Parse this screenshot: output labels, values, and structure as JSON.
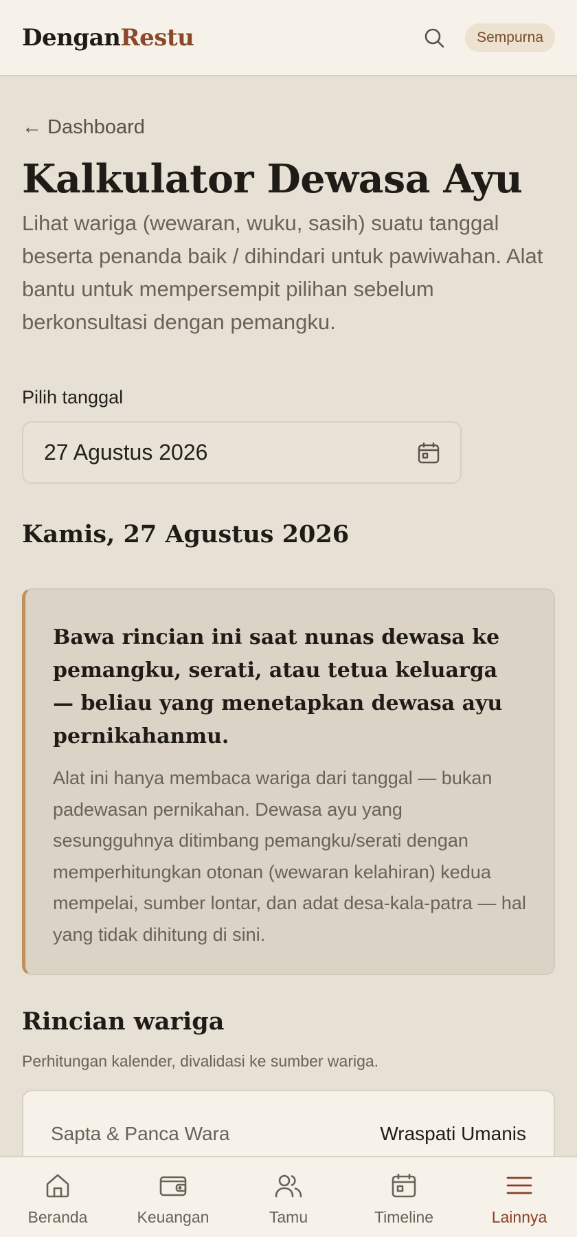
{
  "header": {
    "logo_part1": "Dengan",
    "logo_part2": "Restu",
    "search_icon": "search-icon",
    "plan_badge": "Sempurna"
  },
  "main": {
    "back_link": "← Dashboard",
    "title": "Kalkulator Dewasa Ayu",
    "description": "Lihat wariga (wewaran, wuku, sasih) suatu tanggal beserta penanda baik / dihindari untuk pawiwahan. Alat bantu untuk mempersempit pilihan sebelum berkonsultasi dengan pemangku.",
    "date_field": {
      "label": "Pilih tanggal",
      "value": "27 Agustus 2026",
      "icon": "calendar-icon"
    },
    "selected_date_heading": "Kamis, 27 Agustus 2026",
    "notice": {
      "title": "Bawa rincian ini saat nunas dewasa ke pemangku, serati, atau tetua keluarga — beliau yang menetapkan dewasa ayu pernikahanmu.",
      "body": "Alat ini hanya membaca wariga dari tanggal — bukan padewasan pernikahan. Dewasa ayu yang sesungguhnya ditimbang pemangku/serati dengan memperhitungkan otonan (wewaran kelahiran) kedua mempelai, sumber lontar, dan adat desa-kala-patra — hal yang tidak dihitung di sini.",
      "accent_color": "#c09058"
    },
    "details": {
      "title": "Rincian wariga",
      "subtitle": "Perhitungan kalender, divalidasi ke sumber wariga.",
      "rows": [
        {
          "label": "Sapta & Panca Wara",
          "value": "Wraspati Umanis"
        }
      ]
    }
  },
  "bottom_nav": {
    "items": [
      {
        "label": "Beranda",
        "icon": "home-icon",
        "active": false
      },
      {
        "label": "Keuangan",
        "icon": "wallet-icon",
        "active": false
      },
      {
        "label": "Tamu",
        "icon": "users-icon",
        "active": false
      },
      {
        "label": "Timeline",
        "icon": "calendar-icon",
        "active": false
      },
      {
        "label": "Lainnya",
        "icon": "menu-icon",
        "active": true
      }
    ],
    "active_color": "#8a3f24"
  },
  "colors": {
    "background": "#e7e1d5",
    "surface": "#f6f1e9",
    "brand_accent": "#8a4a2a"
  }
}
